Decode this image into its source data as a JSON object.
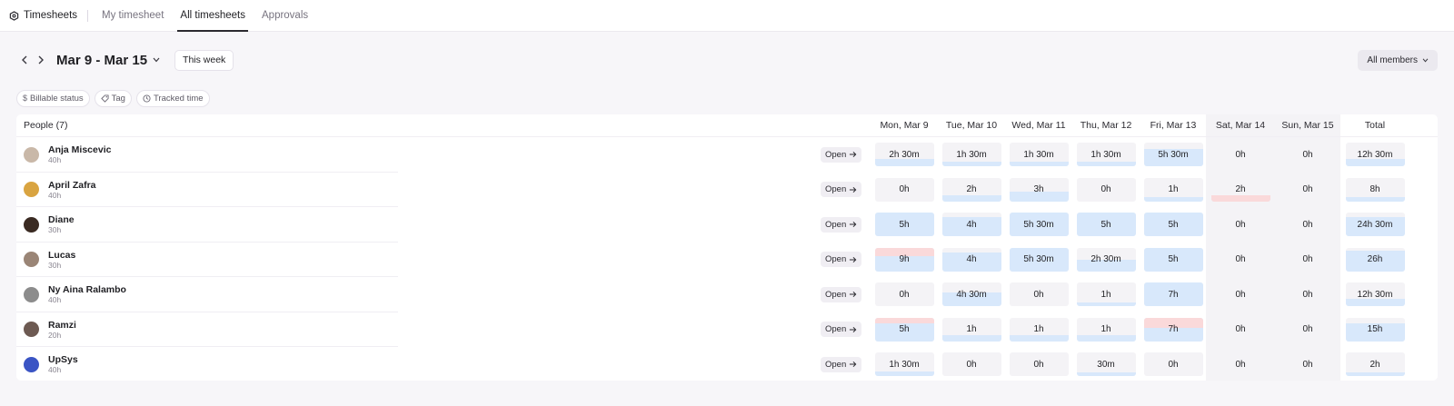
{
  "nav": {
    "brand": "Timesheets",
    "tabs": [
      {
        "label": "My timesheet",
        "active": false
      },
      {
        "label": "All timesheets",
        "active": true
      },
      {
        "label": "Approvals",
        "active": false
      }
    ]
  },
  "toolbar": {
    "prev_icon": "chevron-left-icon",
    "next_icon": "chevron-right-icon",
    "range": "Mar 9 - Mar 15",
    "this_week": "This week",
    "members": "All members"
  },
  "filters": [
    {
      "label": "Billable status",
      "icon": "dollar-icon"
    },
    {
      "label": "Tag",
      "icon": "tag-icon"
    },
    {
      "label": "Tracked time",
      "icon": "clock-icon"
    }
  ],
  "table": {
    "people_header": "People (7)",
    "open_label": "Open",
    "days": [
      "Mon, Mar 9",
      "Tue, Mar 10",
      "Wed, Mar 11",
      "Thu, Mar 12",
      "Fri, Mar 13",
      "Sat, Mar 14",
      "Sun, Mar 15"
    ],
    "total_header": "Total",
    "colors": {
      "fill": "#d8e8fb",
      "over": "#fad9da",
      "cell": "#f4f3f6"
    },
    "rows": [
      {
        "name": "Anja Miscevic",
        "hours": "40h",
        "avatar_color": "#c9b8a8",
        "cells": [
          "2h 30m",
          "1h 30m",
          "1h 30m",
          "1h 30m",
          "5h 30m",
          "0h",
          "0h"
        ],
        "fill": [
          0.3,
          0.2,
          0.2,
          0.2,
          0.75,
          0,
          0
        ],
        "over": [
          0,
          0,
          0,
          0,
          0,
          0,
          0
        ],
        "total": "12h 30m",
        "total_fill": 0.3
      },
      {
        "name": "April Zafra",
        "hours": "40h",
        "avatar_color": "#d9a441",
        "cells": [
          "0h",
          "2h",
          "3h",
          "0h",
          "1h",
          "2h",
          "0h"
        ],
        "fill": [
          0,
          0.25,
          0.4,
          0,
          0.15,
          0.15,
          0
        ],
        "over": [
          0,
          0,
          0,
          0,
          0,
          0.25,
          0
        ],
        "total": "8h",
        "total_fill": 0.2
      },
      {
        "name": "Diane",
        "hours": "30h",
        "avatar_color": "#3a2a22",
        "cells": [
          "5h",
          "4h",
          "5h 30m",
          "5h",
          "5h",
          "0h",
          "0h"
        ],
        "fill": [
          1,
          0.8,
          1,
          1,
          1,
          0,
          0
        ],
        "over": [
          0,
          0,
          0,
          0,
          0,
          0,
          0
        ],
        "total": "24h 30m",
        "total_fill": 0.8
      },
      {
        "name": "Lucas",
        "hours": "30h",
        "avatar_color": "#9a8576",
        "cells": [
          "9h",
          "4h",
          "5h 30m",
          "2h 30m",
          "5h",
          "0h",
          "0h"
        ],
        "fill": [
          1,
          0.8,
          1,
          0.5,
          1,
          0,
          0
        ],
        "over": [
          0.35,
          0,
          0,
          0,
          0,
          0,
          0
        ],
        "total": "26h",
        "total_fill": 0.87
      },
      {
        "name": "Ny Aina Ralambo",
        "hours": "40h",
        "avatar_color": "#8c8c8c",
        "cells": [
          "0h",
          "4h 30m",
          "0h",
          "1h",
          "7h",
          "0h",
          "0h"
        ],
        "fill": [
          0,
          0.6,
          0,
          0.15,
          1,
          0,
          0
        ],
        "over": [
          0,
          0,
          0,
          0,
          0,
          0,
          0
        ],
        "total": "12h 30m",
        "total_fill": 0.3
      },
      {
        "name": "Ramzi",
        "hours": "20h",
        "avatar_color": "#6d5a52",
        "cells": [
          "5h",
          "1h",
          "1h",
          "1h",
          "7h",
          "0h",
          "0h"
        ],
        "fill": [
          1,
          0.25,
          0.25,
          0.25,
          1,
          0,
          0
        ],
        "over": [
          0.25,
          0,
          0,
          0,
          0.45,
          0,
          0
        ],
        "total": "15h",
        "total_fill": 0.75
      },
      {
        "name": "UpSys",
        "hours": "40h",
        "avatar_color": "#3a54c4",
        "cells": [
          "1h 30m",
          "0h",
          "0h",
          "30m",
          "0h",
          "0h",
          "0h"
        ],
        "fill": [
          0.2,
          0,
          0,
          0.08,
          0,
          0,
          0
        ],
        "over": [
          0,
          0,
          0,
          0,
          0,
          0,
          0
        ],
        "total": "2h",
        "total_fill": 0.05
      }
    ]
  }
}
